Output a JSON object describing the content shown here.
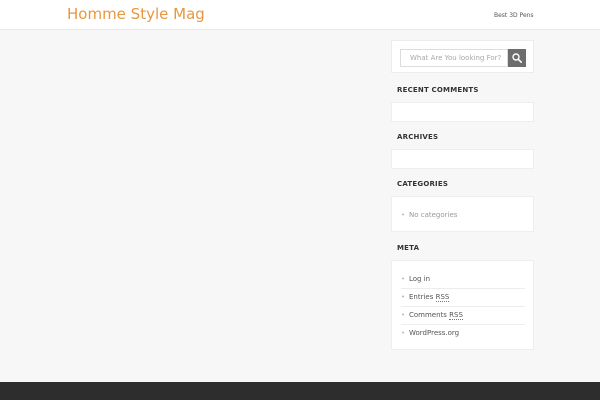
{
  "header": {
    "site_title": "Homme Style Mag",
    "nav_link": "Best 3D Pens"
  },
  "search": {
    "placeholder": "What Are You looking For?",
    "button_icon": "search-icon"
  },
  "widgets": {
    "recent_comments": {
      "title": "RECENT COMMENTS"
    },
    "archives": {
      "title": "ARCHIVES"
    },
    "categories": {
      "title": "CATEGORIES",
      "items": [
        "No categories"
      ]
    },
    "meta": {
      "title": "META",
      "items": [
        {
          "text": "Log in"
        },
        {
          "text": "Entries ",
          "abbr": "RSS"
        },
        {
          "text": "Comments ",
          "abbr": "RSS"
        },
        {
          "text": "WordPress.org"
        }
      ]
    }
  },
  "colors": {
    "accent": "#e8973e",
    "background": "#f7f7f7",
    "footer": "#2d2d2d",
    "search_button": "#6d6d6d"
  }
}
